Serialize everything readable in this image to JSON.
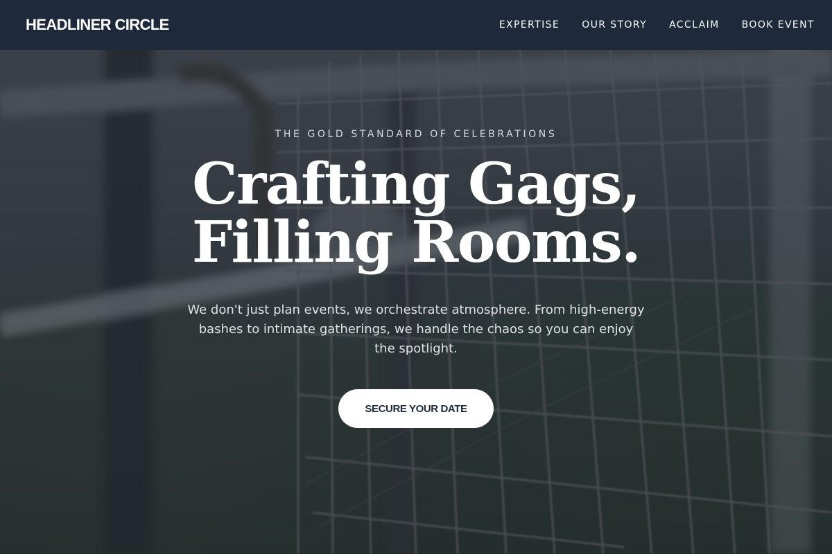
{
  "header": {
    "brand": "HEADLINER CIRCLE",
    "nav": [
      {
        "label": "EXPERTISE"
      },
      {
        "label": "OUR STORY"
      },
      {
        "label": "ACCLAIM"
      },
      {
        "label": "BOOK EVENT"
      }
    ]
  },
  "hero": {
    "eyebrow": "THE GOLD STANDARD OF CELEBRATIONS",
    "headline_line1": "Crafting Gags,",
    "headline_line2": "Filling Rooms.",
    "subtext": "We don't just plan events, we orchestrate atmosphere. From high-energy bashes to intimate gatherings, we handle the chaos so you can enjoy the spotlight.",
    "cta_label": "SECURE YOUR DATE",
    "background_image": "blurred-wire-fence-photo"
  },
  "colors": {
    "header_bg": "#1e2a3c",
    "text_primary": "#ffffff",
    "cta_bg": "#ffffff",
    "cta_text": "#1e2a3c"
  }
}
